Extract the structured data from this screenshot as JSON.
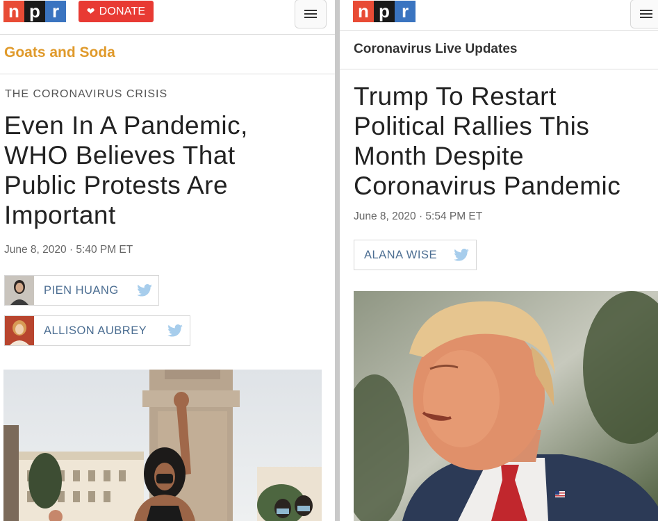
{
  "left": {
    "logo_letters": [
      "n",
      "p",
      "r"
    ],
    "donate_label": "DONATE",
    "section_title": "Goats and Soda",
    "kicker": "THE CORONAVIRUS CRISIS",
    "headline_lines": [
      "Even In A Pandemic,",
      "WHO Believes That",
      "Public Protests Are",
      "Important"
    ],
    "dateline": "June 8, 2020 · 5:40 PM ET",
    "authors": [
      "PIEN HUANG",
      "ALLISON AUBREY"
    ]
  },
  "right": {
    "logo_letters": [
      "n",
      "p",
      "r"
    ],
    "section_title": "Coronavirus Live Updates",
    "headline_lines": [
      "Trump To Restart",
      "Political Rallies This",
      "Month Despite",
      "Coronavirus Pandemic"
    ],
    "dateline": "June 8, 2020 · 5:54 PM ET",
    "authors": [
      "ALANA WISE"
    ]
  },
  "colors": {
    "npr_n": "#e84b35",
    "npr_p": "#1a1a1a",
    "npr_r": "#3a74c0",
    "donate": "#e83a33",
    "goats_and_soda": "#e09a2b",
    "byline_text": "#4c6e92",
    "twitter": "#a7cdec"
  },
  "icons": [
    "heart-icon",
    "hamburger-menu-icon",
    "twitter-icon"
  ]
}
